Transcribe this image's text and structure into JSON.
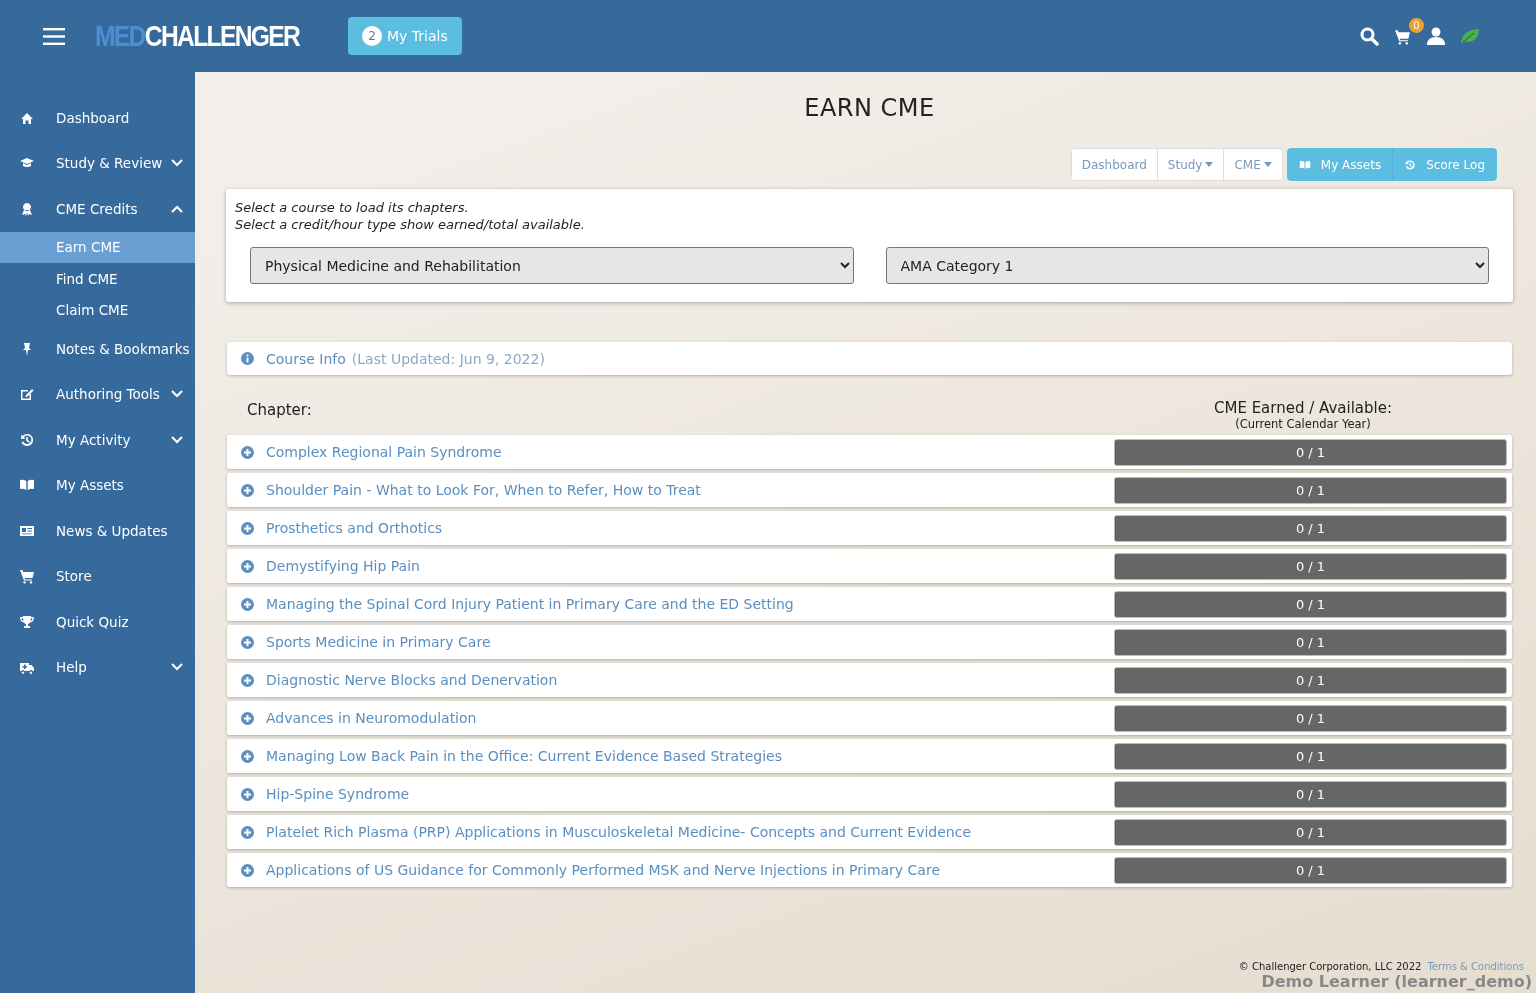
{
  "header": {
    "logo": {
      "part_1": "MED",
      "part_2": "CHALLENGER"
    },
    "trials_button": {
      "count": "2",
      "label": "My Trials"
    },
    "cart_count": "0"
  },
  "sidebar": {
    "items": [
      {
        "label": "Dashboard",
        "selected": false
      },
      {
        "label": "Study & Review",
        "selected": false,
        "expanded": false
      },
      {
        "label": "CME Credits",
        "selected": false,
        "expanded": true,
        "children": [
          {
            "label": "Earn CME",
            "selected": true
          },
          {
            "label": "Find CME",
            "selected": false
          },
          {
            "label": "Claim CME",
            "selected": false
          }
        ]
      },
      {
        "label": "Notes & Bookmarks",
        "selected": false
      },
      {
        "label": "Authoring Tools",
        "selected": false,
        "expanded": false
      },
      {
        "label": "My Activity",
        "selected": false,
        "expanded": false
      },
      {
        "label": "My Assets",
        "selected": false
      },
      {
        "label": "News & Updates",
        "selected": false
      },
      {
        "label": "Store",
        "selected": false
      },
      {
        "label": "Quick Quiz",
        "selected": false
      },
      {
        "label": "Help",
        "selected": false,
        "expanded": false
      }
    ]
  },
  "page": {
    "title": "EARN CME",
    "nav_buttons": [
      {
        "label": "Dashboard",
        "kind": "plain"
      },
      {
        "label": "Study",
        "kind": "dropdown"
      },
      {
        "label": "CME",
        "kind": "dropdown"
      },
      {
        "label": "My Assets",
        "kind": "primary"
      },
      {
        "label": "Score Log",
        "kind": "primary"
      }
    ],
    "instructions": [
      "Select a course to load its chapters.",
      "Select a credit/hour type show earned/total available."
    ],
    "course_select": {
      "value": "Physical Medicine and Rehabilitation"
    },
    "credit_select": {
      "value": "AMA Category 1"
    },
    "course_info": {
      "link": "Course Info",
      "updated": "(Last Updated: Jun 9, 2022)"
    },
    "chapter_heading": "Chapter:",
    "earned_heading": "CME Earned / Available:",
    "earned_subheading": "(Current Calendar Year)",
    "chapters": [
      {
        "title": "Complex Regional Pain Syndrome",
        "reading": "0 / 1",
        "level": 0
      },
      {
        "title": "Shoulder Pain - What to Look For, When to Refer, How to Treat",
        "reading": "0 / 1",
        "level": 0
      },
      {
        "title": "Prosthetics and Orthotics",
        "reading": "0 / 1",
        "level": 0
      },
      {
        "title": "Demystifying Hip Pain",
        "reading": "0 / 1",
        "level": 0
      },
      {
        "title": "Managing the Spinal Cord Injury Patient in Primary Care and the ED Setting",
        "reading": "0 / 1",
        "level": 0
      },
      {
        "title": "Sports Medicine in Primary Care",
        "reading": "0 / 1",
        "level": 0
      },
      {
        "title": "Diagnostic Nerve Blocks and Denervation",
        "reading": "0 / 1",
        "level": 0
      },
      {
        "title": "Advances in Neuromodulation",
        "reading": "0 / 1",
        "level": 0
      },
      {
        "title": "Managing Low Back Pain in the Office: Current Evidence Based Strategies",
        "reading": "0 / 1",
        "level": 0
      },
      {
        "title": "Hip-Spine Syndrome",
        "reading": "0 / 1",
        "level": 0
      },
      {
        "title": "Platelet Rich Plasma (PRP) Applications in Musculoskeletal Medicine- Concepts and Current Evidence",
        "reading": "0 / 1",
        "level": 0
      },
      {
        "title": "Applications of US Guidance for Commonly Performed MSK and Nerve Injections in Primary Care",
        "reading": "0 / 1",
        "level": 0
      }
    ]
  },
  "footer": {
    "copyright": "© Challenger Corporation, LLC 2022",
    "terms_link": "Terms & Conditions",
    "user": "Demo Learner (learner_demo)"
  }
}
